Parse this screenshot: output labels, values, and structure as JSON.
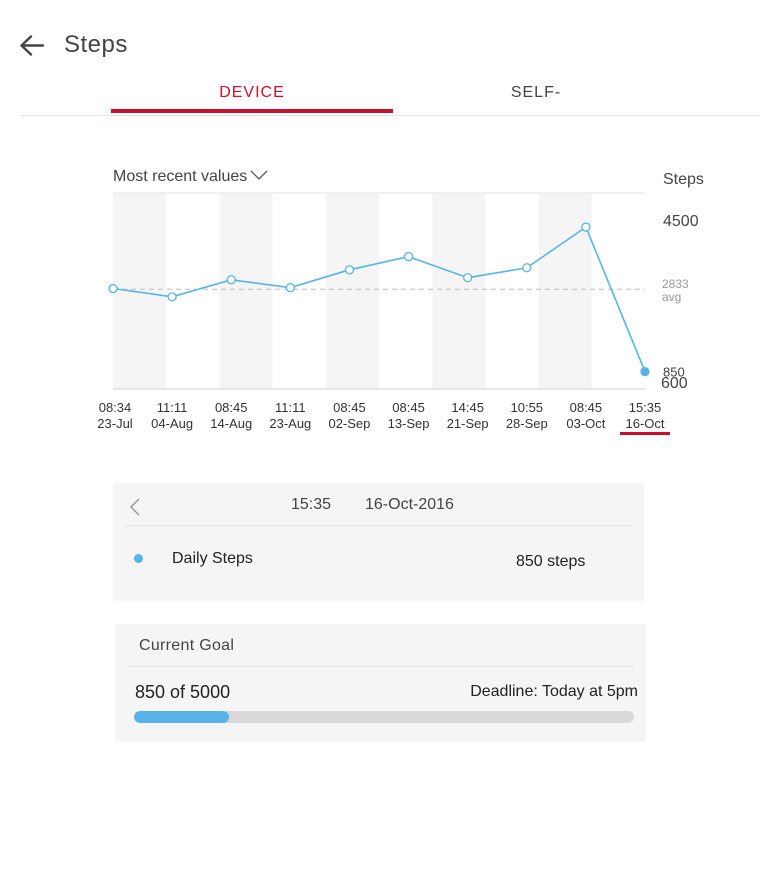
{
  "header": {
    "title": "Steps"
  },
  "tabs": [
    {
      "label": "DEVICE",
      "active": true
    },
    {
      "label": "SELF-",
      "active": false
    }
  ],
  "filter": {
    "label": "Most recent values"
  },
  "chart_data": {
    "type": "line",
    "title": "",
    "ylabel": "Steps",
    "ylim": [
      600,
      4500
    ],
    "y_ticks": [
      "4500",
      "600"
    ],
    "average": {
      "value": 2833,
      "label": "2833",
      "sublabel": "avg"
    },
    "last_value_label": "850",
    "x": [
      {
        "time": "08:34",
        "date": "23-Jul"
      },
      {
        "time": "11:11",
        "date": "04-Aug"
      },
      {
        "time": "08:45",
        "date": "14-Aug"
      },
      {
        "time": "11:11",
        "date": "23-Aug"
      },
      {
        "time": "08:45",
        "date": "02-Sep"
      },
      {
        "time": "08:45",
        "date": "13-Sep"
      },
      {
        "time": "14:45",
        "date": "21-Sep"
      },
      {
        "time": "10:55",
        "date": "28-Sep"
      },
      {
        "time": "08:45",
        "date": "03-Oct"
      },
      {
        "time": "15:35",
        "date": "16-Oct"
      }
    ],
    "series": [
      {
        "values": [
          2850,
          2650,
          3060,
          2870,
          3300,
          3620,
          3110,
          3350,
          4330,
          850
        ]
      }
    ],
    "selected_index": 9,
    "grid": false,
    "colors": {
      "line": "#58b4e8",
      "band": "#f5f5f5",
      "avg": "#bbbbbb",
      "selected": "#c8102e"
    }
  },
  "detail": {
    "time": "15:35",
    "date": "16-Oct-2016",
    "label": "Daily Steps",
    "value": "850 steps",
    "dot_color": "#58b4e8"
  },
  "goal": {
    "title": "Current Goal",
    "progress_text": "850 of 5000",
    "deadline": "Deadline: Today at 5pm",
    "progress": 0.19
  }
}
